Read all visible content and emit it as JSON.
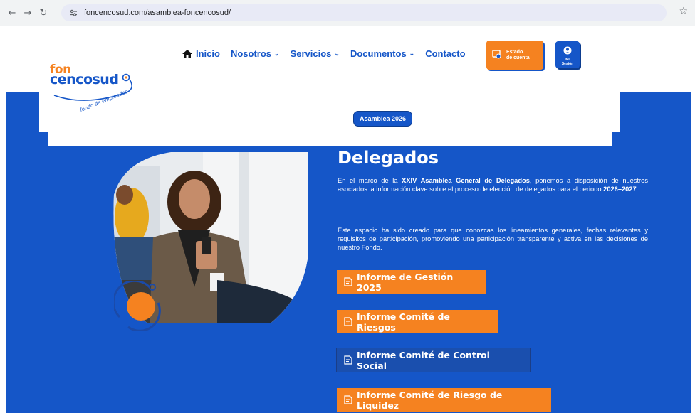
{
  "browser": {
    "url": "foncencosud.com/asamblea-foncencosud/"
  },
  "logo": {
    "line1": "fon",
    "line2": "cencosud",
    "tagline": "fondo de empleados"
  },
  "nav": {
    "items": [
      {
        "label": "Inicio"
      },
      {
        "label": "Nosotros"
      },
      {
        "label": "Servicios"
      },
      {
        "label": "Documentos"
      },
      {
        "label": "Contacto"
      }
    ],
    "estado_line1": "Estado",
    "estado_line2": "de cuenta",
    "sesion_line1": "Mi",
    "sesion_line2": "Sesión",
    "pill": "Asamblea 2026"
  },
  "content": {
    "partial_heading": "Elección de Delegados",
    "title": "Delegados",
    "p1_a": "En el marco de la ",
    "p1_b": "XXIV Asamblea General de Delegados",
    "p1_c": ", ponemos a disposición de nuestros asociados la información clave sobre el proceso de elección de delegados para el periodo ",
    "p1_d": "2026–2027",
    "p1_e": ".",
    "p2": "Este espacio ha sido creado para que conozcas los lineamientos generales, fechas relevantes y requisitos de participación, promoviendo una participación transparente y activa en las decisiones de nuestro Fondo."
  },
  "buttons": [
    {
      "label": "Informe de Gestión 2025"
    },
    {
      "label": "Informe Comité de Riesgos"
    },
    {
      "label": "Informe Comité de Control Social"
    },
    {
      "label": "Informe Comité de Riesgo de Liquidez"
    }
  ],
  "colors": {
    "brand_blue": "#1556c8",
    "brand_orange": "#f58220"
  }
}
